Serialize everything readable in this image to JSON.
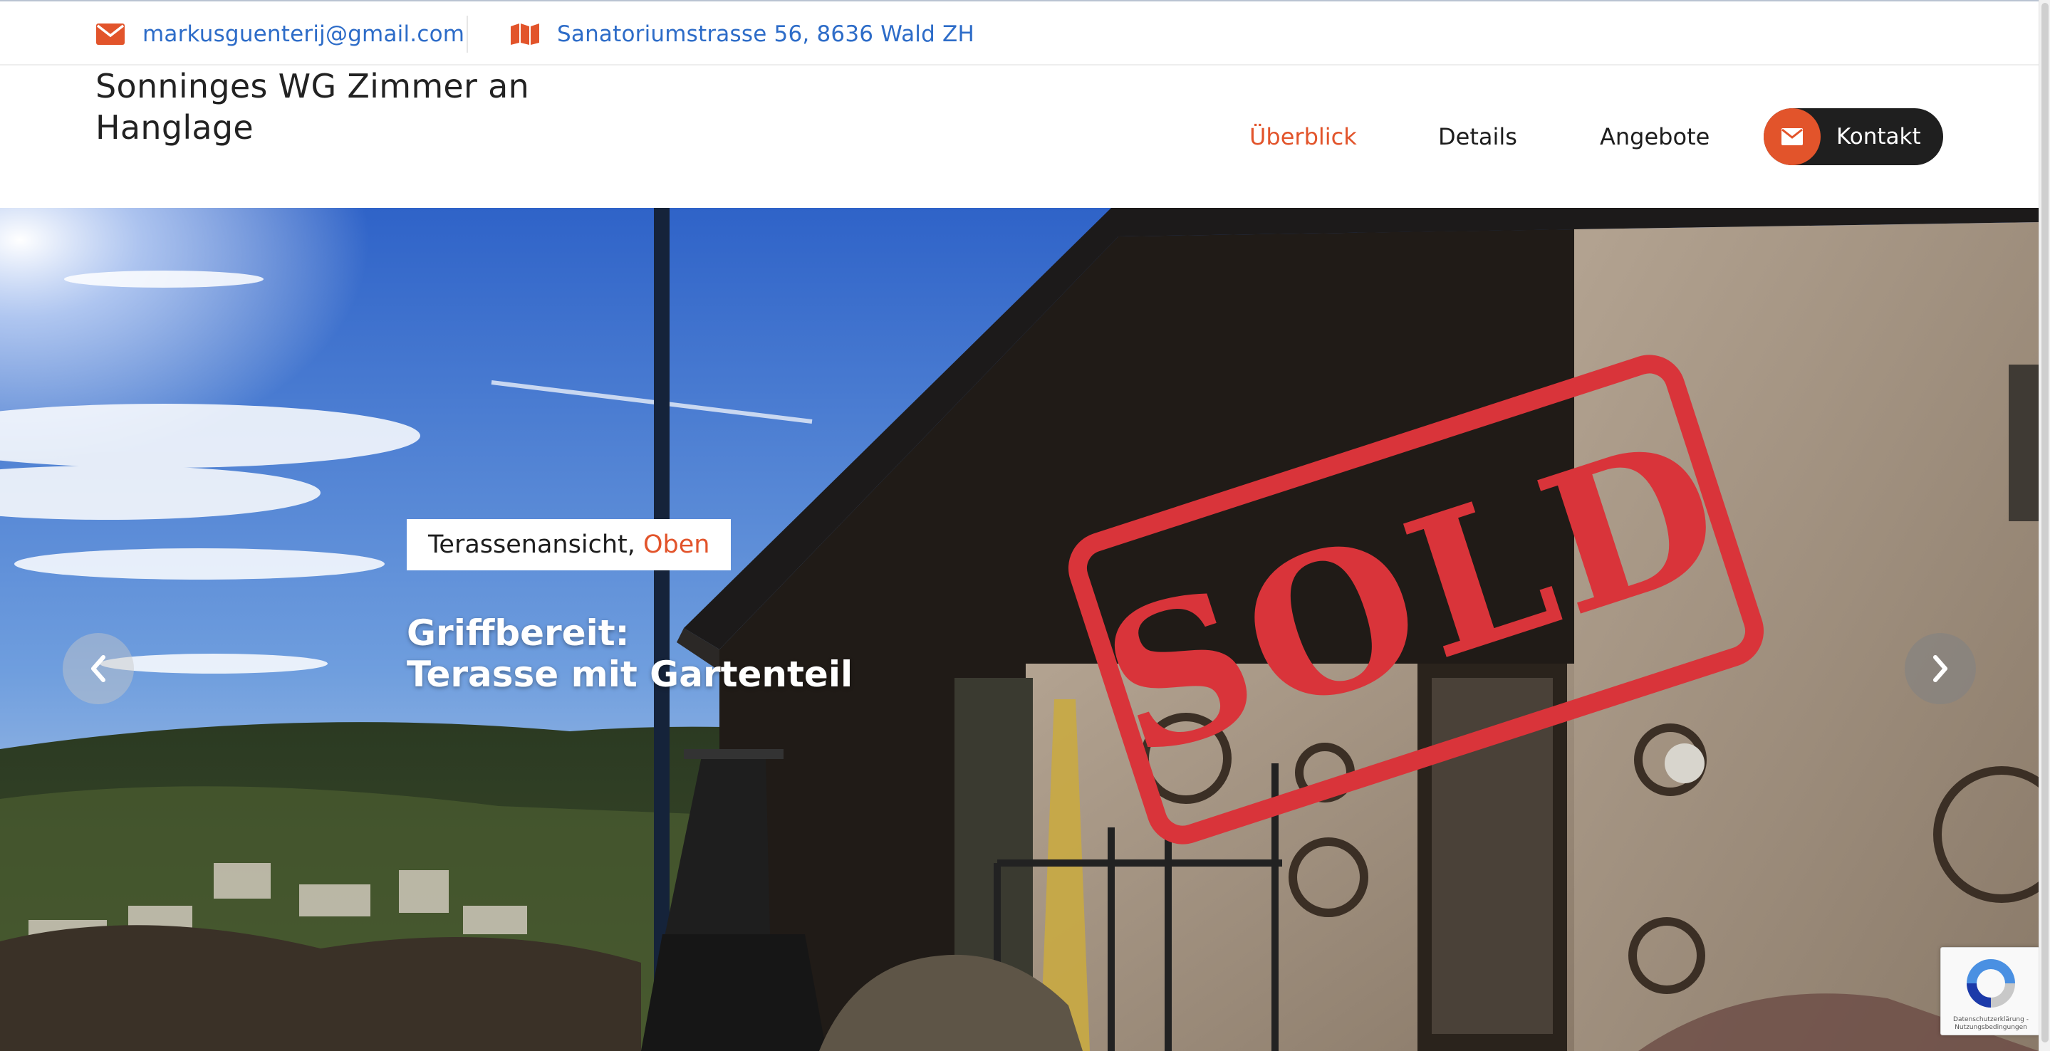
{
  "topbar": {
    "email": "markusguenterij@gmail.com",
    "address": "Sanatoriumstrasse 56, 8636 Wald ZH",
    "email_icon": "envelope-icon",
    "address_icon": "map-icon"
  },
  "header": {
    "brand": "Sonninges WG Zimmer an Hanglage",
    "nav": [
      {
        "label": "Überblick",
        "active": true
      },
      {
        "label": "Details",
        "active": false
      },
      {
        "label": "Angebote",
        "active": false
      }
    ],
    "contact_button": "Kontakt"
  },
  "hero": {
    "tag_main": "Terassenansicht,",
    "tag_highlight": "Oben",
    "headline_line1": "Griffbereit:",
    "headline_line2": "Terasse mit Gartenteil",
    "stamp_text": "SOLD"
  },
  "recaptcha": {
    "terms": "Datenschutzerklärung - Nutzungsbedingungen"
  },
  "colors": {
    "accent": "#e2542b",
    "link": "#2d6cc8",
    "dark": "#1f1f1f",
    "stamp": "#d9343a"
  }
}
